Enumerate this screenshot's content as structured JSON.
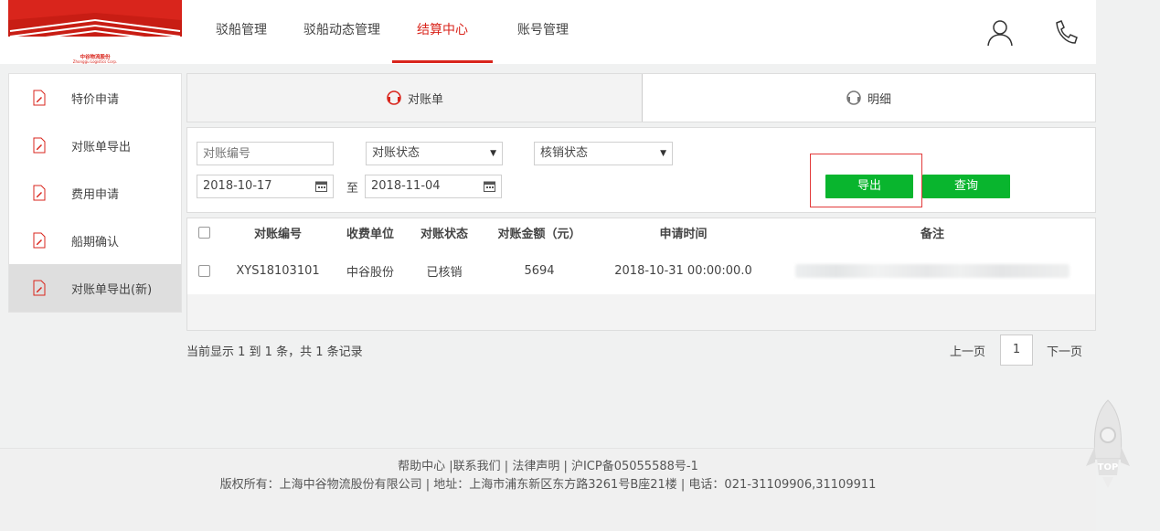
{
  "logo": {
    "brand_cn": "中谷物流股份",
    "brand_en": "Zhonggu Logistics Corp."
  },
  "nav": {
    "items": [
      {
        "label": "驳船管理"
      },
      {
        "label": "驳船动态管理"
      },
      {
        "label": "结算中心"
      },
      {
        "label": "账号管理"
      }
    ],
    "active": "结算中心"
  },
  "header_icons": [
    "user-icon",
    "phone-icon"
  ],
  "sidebar": {
    "items": [
      {
        "label": "特价申请",
        "icon": "edit-doc-icon"
      },
      {
        "label": "对账单导出",
        "icon": "edit-doc-icon"
      },
      {
        "label": "费用申请",
        "icon": "edit-doc-icon"
      },
      {
        "label": "船期确认",
        "icon": "edit-doc-icon"
      },
      {
        "label": "对账单导出(新)",
        "icon": "edit-doc-icon"
      }
    ],
    "active": "对账单导出(新)"
  },
  "tabs": [
    {
      "label": "对账单",
      "icon": "headset-icon"
    },
    {
      "label": "明细",
      "icon": "headset-icon"
    }
  ],
  "filter": {
    "bill_no_placeholder": "对账编号",
    "bill_status_value": "对账状态",
    "writeoff_status_value": "核销状态",
    "date_from": "2018-10-17",
    "date_sep": "至",
    "date_to": "2018-11-04",
    "export_label": "导出",
    "query_label": "查询"
  },
  "table": {
    "headers": [
      "对账编号",
      "收费单位",
      "对账状态",
      "对账金额（元）",
      "申请时间",
      "备注"
    ],
    "rows": [
      [
        "XYS18103101",
        "中谷股份",
        "已核销",
        "5694",
        "2018-10-31 00:00:00.0",
        ""
      ]
    ]
  },
  "pagination": {
    "summary": "当前显示 1 到 1 条，共 1 条记录",
    "prev": "上一页",
    "current": "1",
    "next": "下一页"
  },
  "footer": {
    "line1": "帮助中心 |联系我们 | 法律声明 | 沪ICP备05055588号-1",
    "line2": "版权所有：上海中谷物流股份有限公司 | 地址：上海市浦东新区东方路3261号B座21楼 | 电话：021-31109906,31109911"
  },
  "back_to_top": "TOP",
  "colors": {
    "accent": "#d9251c",
    "button_green": "#09b52e",
    "highlight_border": "#e23a3a"
  }
}
